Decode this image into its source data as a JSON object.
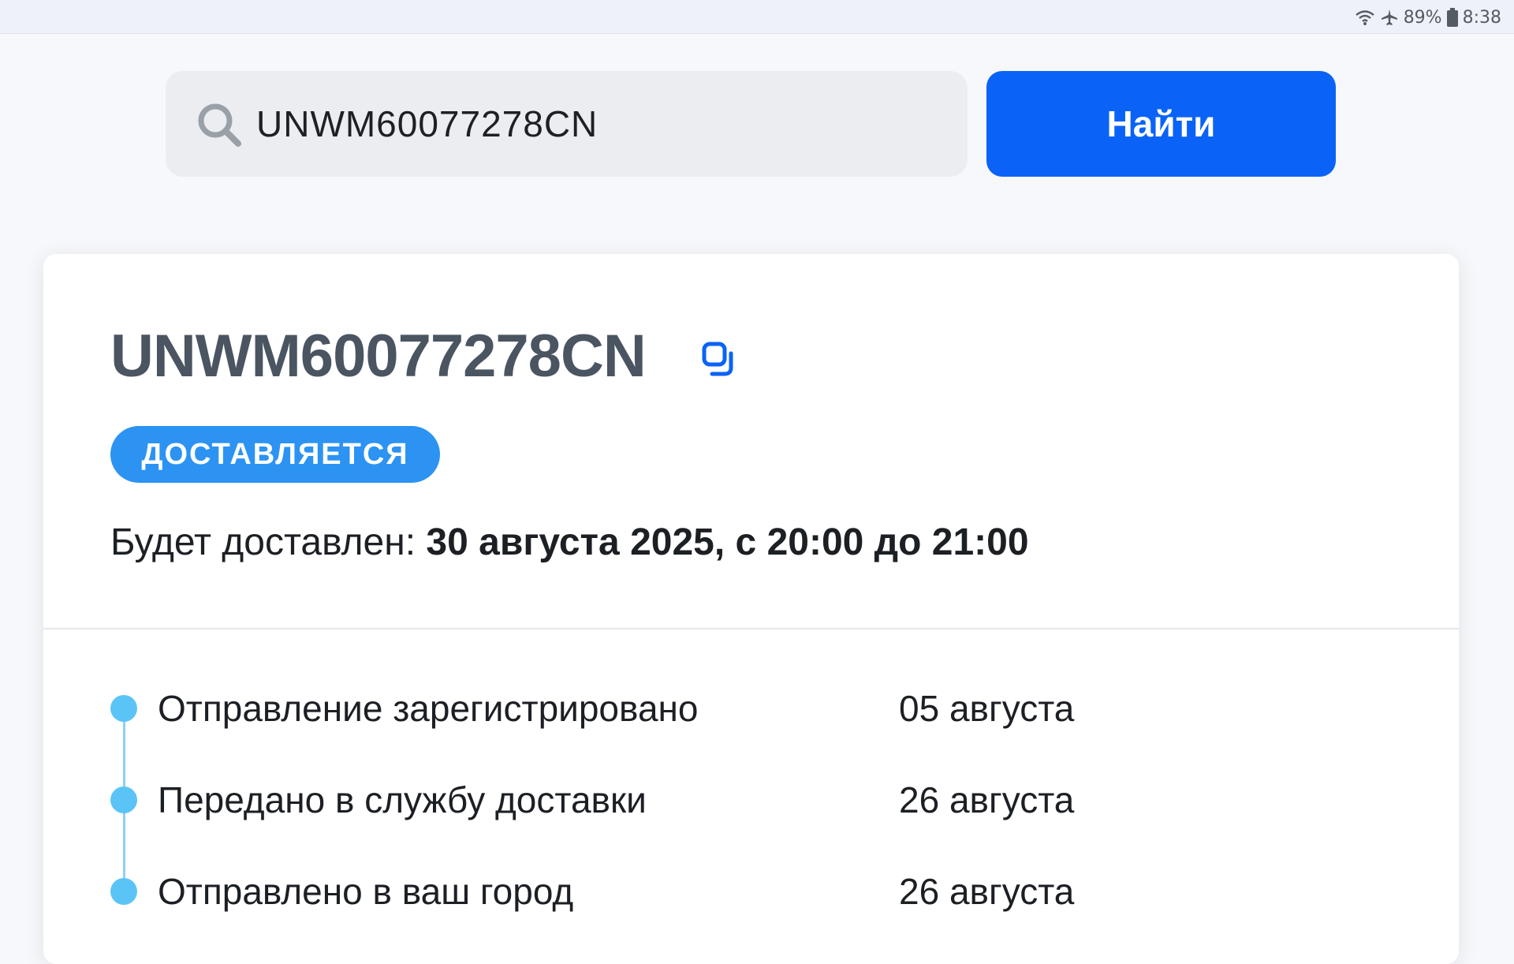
{
  "status_bar": {
    "battery": "89%",
    "time": "8:38",
    "icons": [
      "wifi-icon",
      "airplane-icon",
      "battery-icon"
    ]
  },
  "search": {
    "value": "UNWM60077278CN",
    "button_label": "Найти",
    "icon": "search-icon"
  },
  "shipment": {
    "tracking_number": "UNWM60077278CN",
    "copy_icon": "copy-icon",
    "status": "ДОСТАВЛЯЕТСЯ",
    "eta_label": "Будет доставлен:",
    "eta_value": "30 августа 2025, с 20:00 до 21:00"
  },
  "events": [
    {
      "label": "Отправление зарегистрировано",
      "date": "05 августа"
    },
    {
      "label": "Передано в службу доставки",
      "date": "26 августа"
    },
    {
      "label": "Отправлено в ваш город",
      "date": "26 августа"
    }
  ],
  "colors": {
    "accent": "#0a63f6",
    "badge": "#2c93f2",
    "timeline": "#5bc4f7",
    "title": "#4b5562"
  }
}
